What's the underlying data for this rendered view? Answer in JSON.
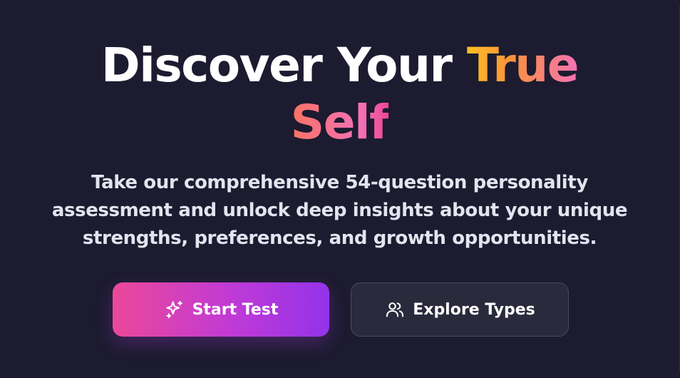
{
  "hero": {
    "title_part1": "Discover Your ",
    "title_accent_1": "True",
    "title_accent_2": "Self",
    "subtitle_line1": "Take our comprehensive 54-question personality",
    "subtitle_line2": "assessment and unlock deep insights about your unique",
    "subtitle_line3": "strengths, preferences, and growth opportunities."
  },
  "actions": {
    "primary": {
      "label": "Start Test",
      "icon": "sparkles-icon"
    },
    "secondary": {
      "label": "Explore Types",
      "icon": "users-icon"
    }
  },
  "colors": {
    "background": "#1c1b30",
    "accent_gold": "#fbbf24",
    "accent_pink": "#ec4899",
    "accent_purple": "#9333ea",
    "secondary_button": "#2a2a3c"
  }
}
